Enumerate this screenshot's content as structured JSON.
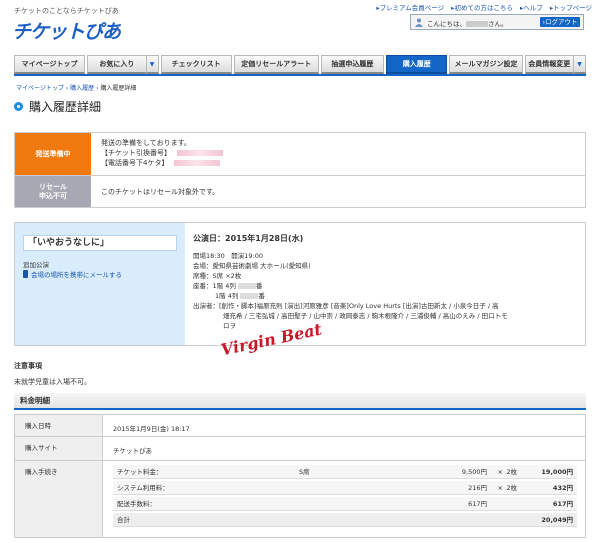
{
  "header": {
    "tagline": "チケットのことならチケットぴあ",
    "logo": "チケットぴあ",
    "toplinks": [
      "プレミアム会員ページ",
      "初めての方はこちら",
      "ヘルプ",
      "トップページ"
    ],
    "greeting_prefix": "こんにちは、",
    "greeting_suffix": "さん。",
    "logout": "ログアウト"
  },
  "nav": {
    "tabs": [
      {
        "label": "マイページトップ",
        "dropdown": false,
        "active": false
      },
      {
        "label": "お気に入り",
        "dropdown": true,
        "active": false
      },
      {
        "label": "チェックリスト",
        "dropdown": false,
        "active": false
      },
      {
        "label": "定価リセールアラート",
        "dropdown": false,
        "active": false
      },
      {
        "label": "抽選申込履歴",
        "dropdown": false,
        "active": false
      },
      {
        "label": "購入履歴",
        "dropdown": false,
        "active": true
      },
      {
        "label": "メールマガジン設定",
        "dropdown": false,
        "active": false
      },
      {
        "label": "会員情報変更",
        "dropdown": true,
        "active": false
      }
    ]
  },
  "breadcrumb": [
    "マイページトップ",
    "購入履歴",
    "購入履歴詳細"
  ],
  "page_title": "購入履歴詳細",
  "status": {
    "shipping": {
      "label": "発送準備中",
      "color": "#f07a10",
      "line1": "発送の準備をしております。",
      "line2": "【チケット引換番号】",
      "line3": "【電話番号下4ケタ】"
    },
    "resale": {
      "label1": "リセール",
      "label2": "申込不可",
      "color": "#a8a8b4",
      "text": "このチケットはリセール対象外です。"
    }
  },
  "performance": {
    "title": "「いやおうなしに」",
    "added": "追加公演",
    "mail_link": "会場の場所を携帯にメールする",
    "date": "公演日：2015年1月28日(水)",
    "time": "開場18:30　開演19:00",
    "venue": "会場：愛知県芸術劇場 大ホール(愛知県)",
    "seat_type": "席種：S席 ×2枚",
    "seat1": "座番：1階 4列",
    "seat1_suffix": "番",
    "seat2": "1階 4列",
    "seat2_suffix": "番",
    "cast_line1": "出演者：[創作・脚本]福原充則 [演出]河原雅彦 [音楽]Only Love Hurts [出演]古田新太 / 小泉今日子 / 高",
    "cast_line2": "畑充希 / 三宅弘城 / 高田聖子 / 山中崇 / 政岡泰志 / 駒木根隆介 / 三浦俊輔 / 高山のえみ / 田口トモ",
    "cast_line3": "ロヲ"
  },
  "watermark": "Virgin Beat",
  "notes": {
    "heading": "注意事項",
    "body": "未就学児童は入場不可。"
  },
  "charges": {
    "heading": "料金明細",
    "purchase_date_label": "購入日時",
    "purchase_date": "2015年1月9日(金) 18:17",
    "site_label": "購入サイト",
    "site": "チケットぴあ",
    "procedure_label": "購入手続き",
    "rows": [
      {
        "name": "チケット料金：",
        "seat": "S席",
        "unit": "9,500円",
        "x": "×",
        "qty": "2枚",
        "sum": "19,000円"
      },
      {
        "name": "システム利用料：",
        "seat": "",
        "unit": "216円",
        "x": "×",
        "qty": "2枚",
        "sum": "432円"
      },
      {
        "name": "配送手数料：",
        "seat": "",
        "unit": "617円",
        "x": "",
        "qty": "",
        "sum": "617円"
      }
    ],
    "total_label": "合計",
    "total": "20,049円"
  },
  "colors": {
    "accent": "#1366c8",
    "shipping_orange": "#f07a10",
    "resale_gray": "#a8a8b4",
    "perf_panel": "#d9ecfb"
  }
}
